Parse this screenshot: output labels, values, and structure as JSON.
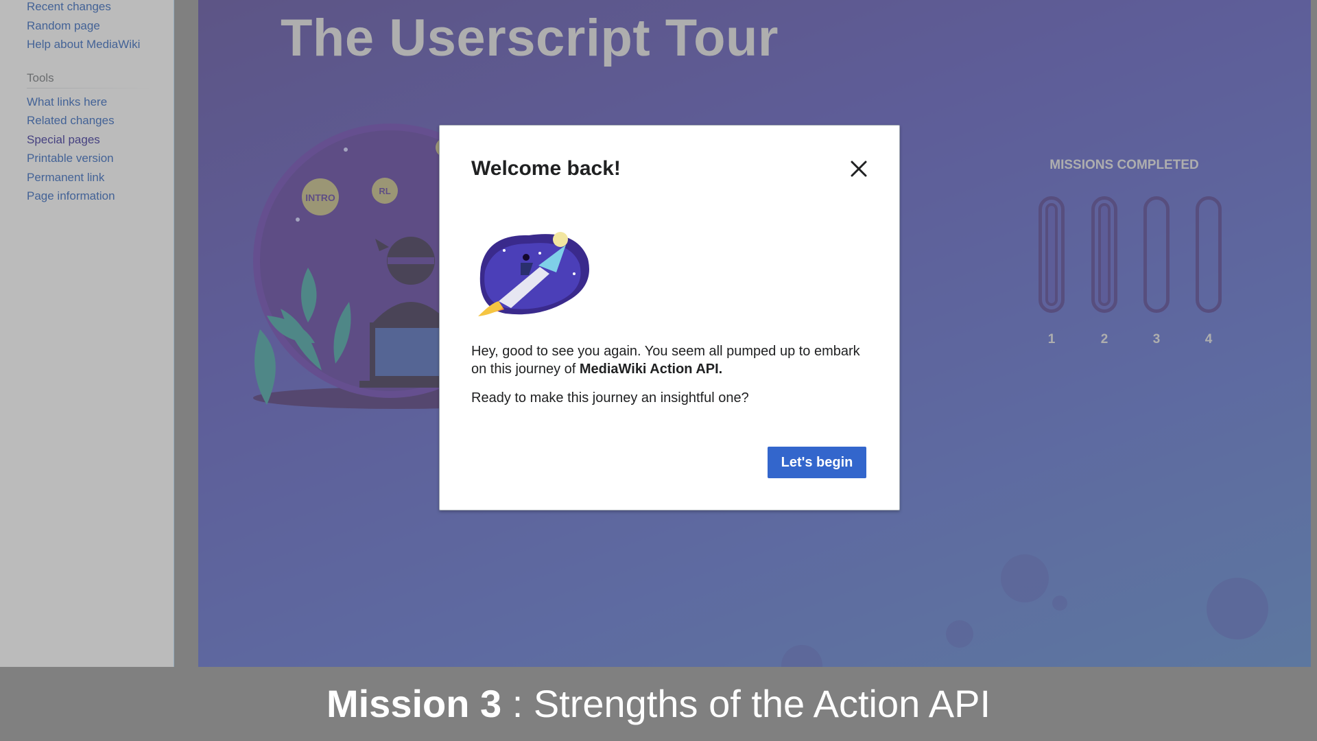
{
  "sidebar": {
    "nav_links": [
      "Recent changes",
      "Random page",
      "Help about MediaWiki"
    ],
    "tools_heading": "Tools",
    "tools_links": [
      "What links here",
      "Related changes",
      "Special pages",
      "Printable version",
      "Permanent link",
      "Page information"
    ]
  },
  "tour": {
    "title": "The Userscript Tour",
    "badges": [
      "INTRO",
      "RL"
    ],
    "missions_title": "MISSIONS COMPLETED",
    "missions": [
      {
        "number": "1",
        "completed": true
      },
      {
        "number": "2",
        "completed": true
      },
      {
        "number": "3",
        "completed": false
      },
      {
        "number": "4",
        "completed": false
      }
    ]
  },
  "modal": {
    "title": "Welcome back!",
    "close_icon": "close-icon",
    "paragraph1_prefix": "Hey, good to see you again. You seem all pumped up to embark on this journey of ",
    "paragraph1_bold": "MediaWiki Action API.",
    "paragraph2": "Ready to make this journey an insightful one?",
    "button_label": "Let's begin"
  },
  "caption": {
    "strong": "Mission 3",
    "rest": " : Strengths of the Action API"
  },
  "colors": {
    "accent_button": "#3366cc",
    "page_background_start": "#3a2a8c",
    "page_background_end": "#3a6fbf",
    "caption_bar": "#808080"
  }
}
